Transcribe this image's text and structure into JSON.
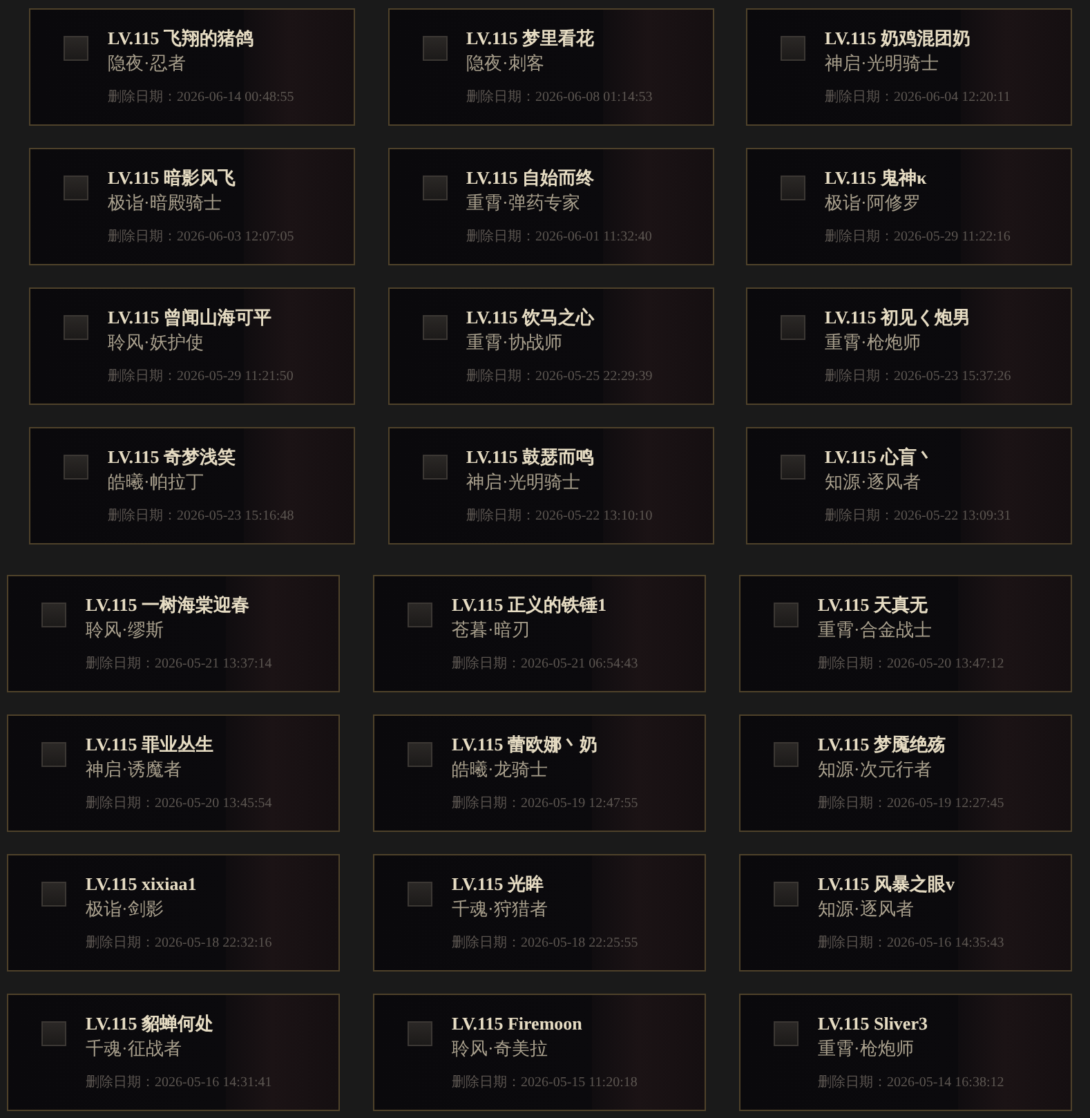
{
  "sections": [
    {
      "cards": [
        {
          "title": "LV.115 飞翔的猪鸽",
          "class": "隐夜·忍者",
          "deleted": "删除日期：2026-06-14 00:48:55",
          "checked": false
        },
        {
          "title": "LV.115 梦里看花",
          "class": "隐夜·刺客",
          "deleted": "删除日期：2026-06-08 01:14:53",
          "checked": false
        },
        {
          "title": "LV.115 奶鸡混团奶",
          "class": "神启·光明骑士",
          "deleted": "删除日期：2026-06-04 12:20:11",
          "checked": false
        },
        {
          "title": "LV.115 暗影风飞",
          "class": "极诣·暗殿骑士",
          "deleted": "删除日期：2026-06-03 12:07:05",
          "checked": false
        },
        {
          "title": "LV.115 自始而终",
          "class": "重霄·弹药专家",
          "deleted": "删除日期：2026-06-01 11:32:40",
          "checked": false
        },
        {
          "title": "LV.115 鬼神κ",
          "class": "极诣·阿修罗",
          "deleted": "删除日期：2026-05-29 11:22:16",
          "checked": false
        },
        {
          "title": "LV.115 曾闻山海可平",
          "class": "聆风·妖护使",
          "deleted": "删除日期：2026-05-29 11:21:50",
          "checked": false
        },
        {
          "title": "LV.115 饮马之心",
          "class": "重霄·协战师",
          "deleted": "删除日期：2026-05-25 22:29:39",
          "checked": false
        },
        {
          "title": "LV.115 初见く炮男",
          "class": "重霄·枪炮师",
          "deleted": "删除日期：2026-05-23 15:37:26",
          "checked": false
        },
        {
          "title": "LV.115 奇梦浅笑",
          "class": "皓曦·帕拉丁",
          "deleted": "删除日期：2026-05-23 15:16:48",
          "checked": false
        },
        {
          "title": "LV.115 鼓瑟而鸣",
          "class": "神启·光明骑士",
          "deleted": "删除日期：2026-05-22 13:10:10",
          "checked": false
        },
        {
          "title": "LV.115 心盲丶",
          "class": "知源·逐风者",
          "deleted": "删除日期：2026-05-22 13:09:31",
          "checked": false
        }
      ]
    },
    {
      "cards": [
        {
          "title": "LV.115 一树海棠迎春",
          "class": "聆风·缪斯",
          "deleted": "删除日期：2026-05-21 13:37:14",
          "checked": false
        },
        {
          "title": "LV.115 正义的铁锤1",
          "class": "苍暮·暗刃",
          "deleted": "删除日期：2026-05-21 06:54:43",
          "checked": false
        },
        {
          "title": "LV.115 天真无",
          "class": "重霄·合金战士",
          "deleted": "删除日期：2026-05-20 13:47:12",
          "checked": false
        },
        {
          "title": "LV.115 罪业丛生",
          "class": "神启·诱魔者",
          "deleted": "删除日期：2026-05-20 13:45:54",
          "checked": false
        },
        {
          "title": "LV.115 蕾欧娜丶奶",
          "class": "皓曦·龙骑士",
          "deleted": "删除日期：2026-05-19 12:47:55",
          "checked": false
        },
        {
          "title": "LV.115 梦魇绝殇",
          "class": "知源·次元行者",
          "deleted": "删除日期：2026-05-19 12:27:45",
          "checked": false
        },
        {
          "title": "LV.115 xixiaa1",
          "class": "极诣·剑影",
          "deleted": "删除日期：2026-05-18 22:32:16",
          "checked": false
        },
        {
          "title": "LV.115 光眸",
          "class": "千魂·狩猎者",
          "deleted": "删除日期：2026-05-18 22:25:55",
          "checked": false
        },
        {
          "title": "LV.115 风暴之眼v",
          "class": "知源·逐风者",
          "deleted": "删除日期：2026-05-16 14:35:43",
          "checked": false
        },
        {
          "title": "LV.115 貂蝉何处",
          "class": "千魂·征战者",
          "deleted": "删除日期：2026-05-16 14:31:41",
          "checked": false
        },
        {
          "title": "LV.115 Firemoon",
          "class": "聆风·奇美拉",
          "deleted": "删除日期：2026-05-15 11:20:18",
          "checked": false
        },
        {
          "title": "LV.115 Sliver3",
          "class": "重霄·枪炮师",
          "deleted": "删除日期：2026-05-14 16:38:12",
          "checked": false
        }
      ]
    }
  ]
}
